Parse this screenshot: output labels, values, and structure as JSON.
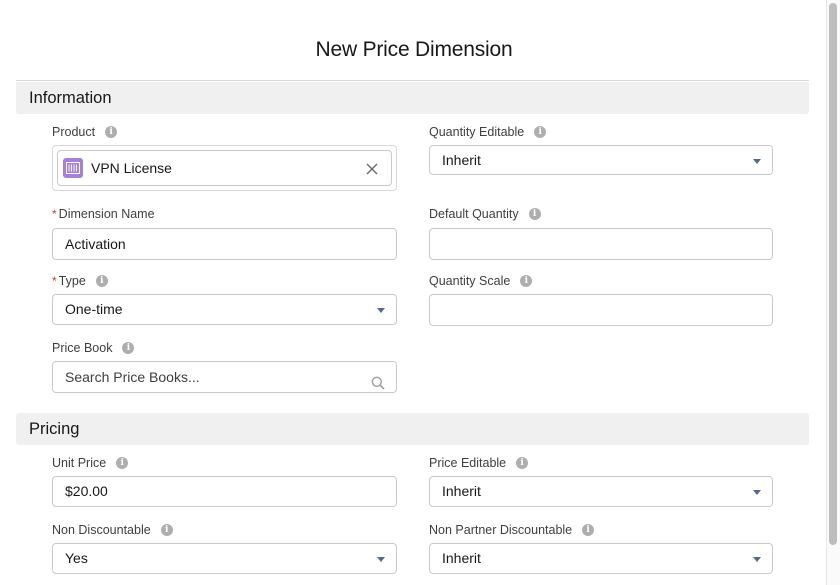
{
  "modal": {
    "title": "New Price Dimension"
  },
  "sections": {
    "information": {
      "title": "Information",
      "product": {
        "label": "Product",
        "value": "VPN License",
        "icon": "product-icon",
        "clear_icon": "close-icon"
      },
      "quantity_editable": {
        "label": "Quantity Editable",
        "value": "Inherit"
      },
      "dimension_name": {
        "label": "Dimension Name",
        "required_marker": "*",
        "value": "Activation"
      },
      "default_quantity": {
        "label": "Default Quantity",
        "value": ""
      },
      "type": {
        "label": "Type",
        "required_marker": "*",
        "value": "One-time"
      },
      "quantity_scale": {
        "label": "Quantity Scale",
        "value": ""
      },
      "price_book": {
        "label": "Price Book",
        "placeholder": "Search Price Books...",
        "icon": "search-icon"
      }
    },
    "pricing": {
      "title": "Pricing",
      "unit_price": {
        "label": "Unit Price",
        "value": "$20.00"
      },
      "price_editable": {
        "label": "Price Editable",
        "value": "Inherit"
      },
      "non_discountable": {
        "label": "Non Discountable",
        "value": "Yes"
      },
      "non_partner_discountable": {
        "label": "Non Partner Discountable",
        "value": "Inherit"
      }
    }
  },
  "info_icon_glyph": "i",
  "colors": {
    "product_icon": "#a77ed8",
    "required": "#c23934",
    "section_bg": "#f0f0f0",
    "chevron": "#54698d"
  }
}
